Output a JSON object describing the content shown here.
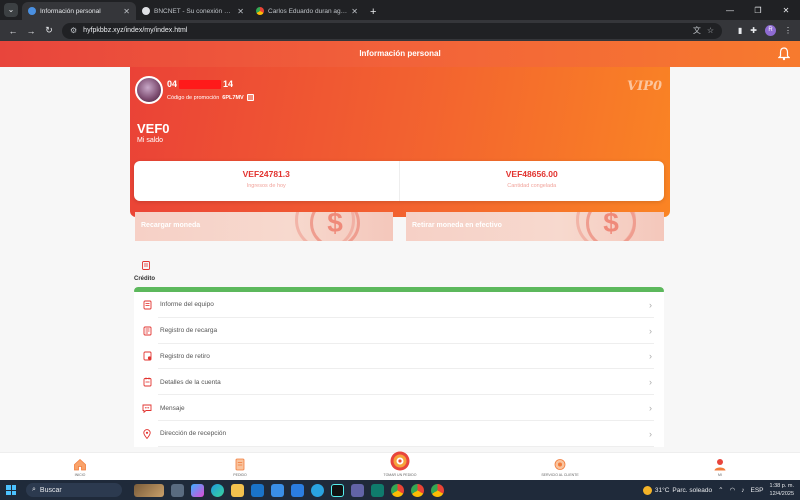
{
  "browser": {
    "tabs": [
      {
        "title": "Información personal",
        "active": true,
        "favicon_color": "#4a90e2"
      },
      {
        "title": "BNCNET - Su conexión con el Ba",
        "active": false,
        "favicon_color": "#dfe1e5"
      },
      {
        "title": "Carlos Eduardo duran aguero |",
        "active": false,
        "favicon_color": "#34a853"
      }
    ],
    "url": "hyfpkbbz.xyz/index/my/index.html",
    "profile_initial": "R"
  },
  "header": {
    "title": "Información personal"
  },
  "profile": {
    "id_prefix": "04",
    "id_suffix": "14",
    "promo_label": "Código de promoción",
    "promo_code": "6PL7MV",
    "vip_label": "VIP0",
    "balance_value": "VEF0",
    "balance_label": "Mi saldo"
  },
  "stats": {
    "today_income_value": "VEF24781.3",
    "today_income_label": "Ingresos de hoy",
    "frozen_value": "VEF48656.00",
    "frozen_label": "Cantidad congelada"
  },
  "banners": {
    "recharge": "Recargar moneda",
    "withdraw": "Retirar moneda en efectivo"
  },
  "credit": {
    "label": "Crédito",
    "progress": 1.0
  },
  "menu": [
    {
      "label": "Informe del equipo",
      "icon": "team-report-icon"
    },
    {
      "label": "Registro de recarga",
      "icon": "recharge-record-icon"
    },
    {
      "label": "Registro de retiro",
      "icon": "withdraw-record-icon"
    },
    {
      "label": "Detalles de la cuenta",
      "icon": "account-details-icon"
    },
    {
      "label": "Mensaje",
      "icon": "message-icon"
    },
    {
      "label": "Dirección de recepción",
      "icon": "location-icon"
    }
  ],
  "bottom_nav": [
    {
      "label": "INICIO",
      "icon": "home-icon"
    },
    {
      "label": "PEDIDO",
      "icon": "order-icon"
    },
    {
      "label": "TOMAR UN PEDIDO",
      "icon": "take-order-icon"
    },
    {
      "label": "SERVICIO AL CLIENTE",
      "icon": "customer-service-icon"
    },
    {
      "label": "MI",
      "icon": "profile-icon"
    }
  ],
  "taskbar": {
    "search_placeholder": "Buscar",
    "weather_temp": "31°C",
    "weather_desc": "Parc. soleado",
    "language": "ESP",
    "time": "1:38 p. m.",
    "date": "12/4/2025"
  },
  "colors": {
    "accent": "#e8453c",
    "accent_end": "#fa8424",
    "stat_value": "#e2332f",
    "progress": "#5cb85c"
  }
}
